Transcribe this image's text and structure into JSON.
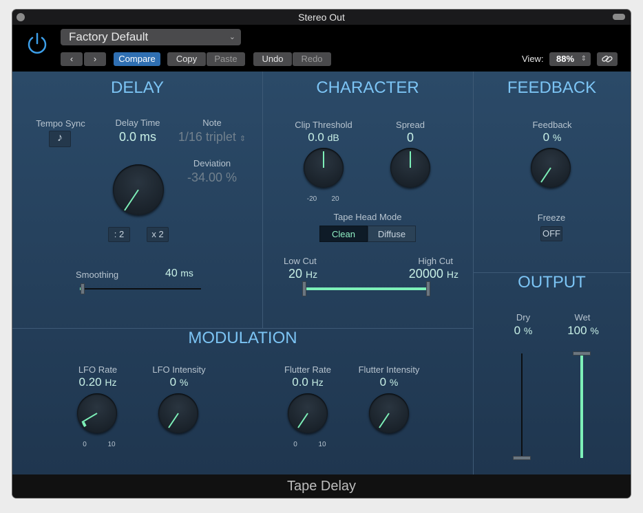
{
  "window": {
    "title": "Stereo Out"
  },
  "header": {
    "preset": "Factory Default",
    "compare": "Compare",
    "copy": "Copy",
    "paste": "Paste",
    "undo": "Undo",
    "redo": "Redo",
    "view_label": "View:",
    "view_value": "88%"
  },
  "delay": {
    "title": "DELAY",
    "tempo_sync_label": "Tempo Sync",
    "delay_time_label": "Delay Time",
    "delay_time_value": "0.0 ms",
    "note_label": "Note",
    "note_value": "1/16 triplet",
    "deviation_label": "Deviation",
    "deviation_value": "-34.00 %",
    "div2": ": 2",
    "mul2": "x 2",
    "smoothing_label": "Smoothing",
    "smoothing_value": "40",
    "smoothing_unit": "ms"
  },
  "character": {
    "title": "CHARACTER",
    "clip_label": "Clip Threshold",
    "clip_value": "0.0",
    "clip_unit": "dB",
    "clip_min": "-20",
    "clip_max": "20",
    "spread_label": "Spread",
    "spread_value": "0",
    "tape_head_label": "Tape Head Mode",
    "mode_clean": "Clean",
    "mode_diffuse": "Diffuse",
    "low_cut_label": "Low Cut",
    "low_cut_value": "20",
    "low_cut_unit": "Hz",
    "high_cut_label": "High Cut",
    "high_cut_value": "20000",
    "high_cut_unit": "Hz"
  },
  "feedback": {
    "title": "FEEDBACK",
    "feedback_label": "Feedback",
    "feedback_value": "0",
    "feedback_unit": "%",
    "freeze_label": "Freeze",
    "freeze_value": "OFF"
  },
  "output": {
    "title": "OUTPUT",
    "dry_label": "Dry",
    "dry_value": "0",
    "dry_unit": "%",
    "dry_level": 0,
    "wet_label": "Wet",
    "wet_value": "100",
    "wet_unit": "%",
    "wet_level": 1
  },
  "modulation": {
    "title": "MODULATION",
    "lfo_rate_label": "LFO Rate",
    "lfo_rate_value": "0.20",
    "lfo_rate_unit": "Hz",
    "lfo_rate_min": "0",
    "lfo_rate_max": "10",
    "lfo_int_label": "LFO Intensity",
    "lfo_int_value": "0",
    "lfo_int_unit": "%",
    "flutter_rate_label": "Flutter Rate",
    "flutter_rate_value": "0.0",
    "flutter_rate_unit": "Hz",
    "flutter_rate_min": "0",
    "flutter_rate_max": "10",
    "flutter_int_label": "Flutter Intensity",
    "flutter_int_value": "0",
    "flutter_int_unit": "%"
  },
  "footer": {
    "plugin_name": "Tape Delay"
  },
  "colors": {
    "accent": "#7df0b8",
    "section_title": "#7cc4f4",
    "compare_active": "#2f6fb2"
  }
}
